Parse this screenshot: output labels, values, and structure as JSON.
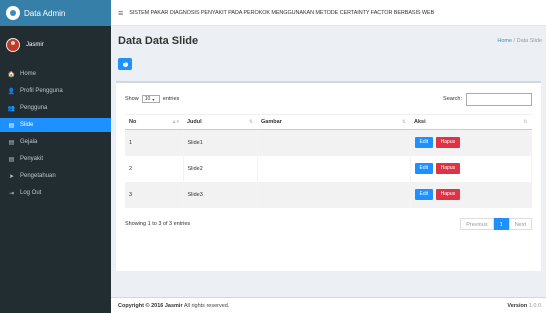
{
  "brand": {
    "text": "Data Admin"
  },
  "user": {
    "name": "Jasmir"
  },
  "sidebar": {
    "items": [
      {
        "label": "Home",
        "icon": "home-icon",
        "glyph": "🏠"
      },
      {
        "label": "Profil Pengguna",
        "icon": "user-icon",
        "glyph": "👤"
      },
      {
        "label": "Pengguna",
        "icon": "users-icon",
        "glyph": "👥"
      },
      {
        "label": "Slide",
        "icon": "file-icon",
        "glyph": "▤",
        "active": true
      },
      {
        "label": "Gejala",
        "icon": "file-icon",
        "glyph": "▤"
      },
      {
        "label": "Penyakit",
        "icon": "file-icon",
        "glyph": "▤"
      },
      {
        "label": "Pengetahuan",
        "icon": "send-icon",
        "glyph": "➤"
      },
      {
        "label": "Log Out",
        "icon": "sign-out-icon",
        "glyph": "⇥"
      }
    ]
  },
  "header": {
    "title": "SISTEM PAKAR DIAGNOSIS PENYAKIT PADA PEROKOK MENGGUNAKAN METODE CERTAINTY FACTOR BERBASIS WEB"
  },
  "page": {
    "title": "Data Data Slide",
    "breadcrumb": {
      "home": "Home",
      "sep": "/",
      "current": "Data Slide"
    }
  },
  "table_controls": {
    "show_label": "Show",
    "entries_value": "10",
    "entries_label": "entries",
    "search_label": "Search:",
    "search_value": ""
  },
  "table": {
    "columns": [
      "No",
      "Judul",
      "Gambar",
      "Aksi"
    ],
    "rows": [
      {
        "no": "1",
        "judul": "Slide1",
        "gambar": ""
      },
      {
        "no": "2",
        "judul": "Slide2",
        "gambar": ""
      },
      {
        "no": "3",
        "judul": "Slide3",
        "gambar": ""
      }
    ],
    "edit_label": "Edit",
    "delete_label": "Hapus"
  },
  "pagination": {
    "info": "Showing 1 to 3 of 3 entries",
    "previous": "Previous",
    "current": "1",
    "next": "Next"
  },
  "footer": {
    "copyright_prefix": "Copyright © 2016",
    "copyright_name": "Jasmir",
    "copyright_suffix": "All rights reserved.",
    "version_label": "Version",
    "version_value": "1.0.0"
  },
  "colors": {
    "accent": "#1e90ff",
    "danger": "#dd3344",
    "sidebar": "#222d32",
    "brand": "#367fa9"
  }
}
